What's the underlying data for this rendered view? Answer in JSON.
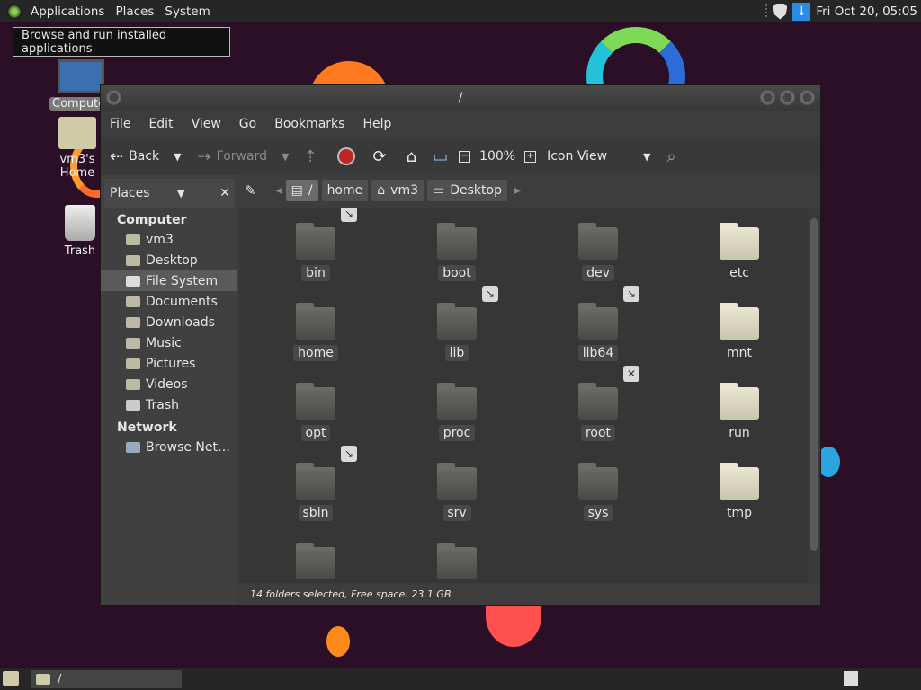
{
  "top_panel": {
    "menus": [
      "Applications",
      "Places",
      "System"
    ],
    "clock": "Fri Oct 20, 05:05"
  },
  "tooltip": "Browse and run installed applications",
  "desktop_icons": [
    {
      "label": "Computer"
    },
    {
      "label": "vm3's Home"
    },
    {
      "label": "Trash"
    }
  ],
  "window": {
    "title": "/",
    "menu": [
      "File",
      "Edit",
      "View",
      "Go",
      "Bookmarks",
      "Help"
    ],
    "toolbar": {
      "back": "Back",
      "forward": "Forward",
      "zoom": "100%",
      "view_mode": "Icon View"
    },
    "sidebar": {
      "selector": "Places",
      "sections": [
        {
          "title": "Computer",
          "items": [
            "vm3",
            "Desktop",
            "File System",
            "Documents",
            "Downloads",
            "Music",
            "Pictures",
            "Videos",
            "Trash"
          ]
        },
        {
          "title": "Network",
          "items": [
            "Browse Net…"
          ]
        }
      ],
      "active": "File System"
    },
    "breadcrumbs": [
      "/",
      "home",
      "vm3",
      "Desktop"
    ],
    "files": [
      {
        "name": "bin",
        "emblem": "link"
      },
      {
        "name": "boot"
      },
      {
        "name": "dev"
      },
      {
        "name": "etc",
        "light": true
      },
      {
        "name": "home"
      },
      {
        "name": "lib",
        "emblem": "link"
      },
      {
        "name": "lib64",
        "emblem": "link"
      },
      {
        "name": "mnt",
        "light": true
      },
      {
        "name": "opt"
      },
      {
        "name": "proc"
      },
      {
        "name": "root",
        "emblem": "x"
      },
      {
        "name": "run",
        "light": true
      },
      {
        "name": "sbin",
        "emblem": "link"
      },
      {
        "name": "srv"
      },
      {
        "name": "sys"
      },
      {
        "name": "tmp",
        "light": true
      },
      {
        "name": ""
      },
      {
        "name": ""
      }
    ],
    "status": "14 folders selected, Free space: 23.1 GB"
  },
  "taskbar": {
    "task_label": "/"
  }
}
